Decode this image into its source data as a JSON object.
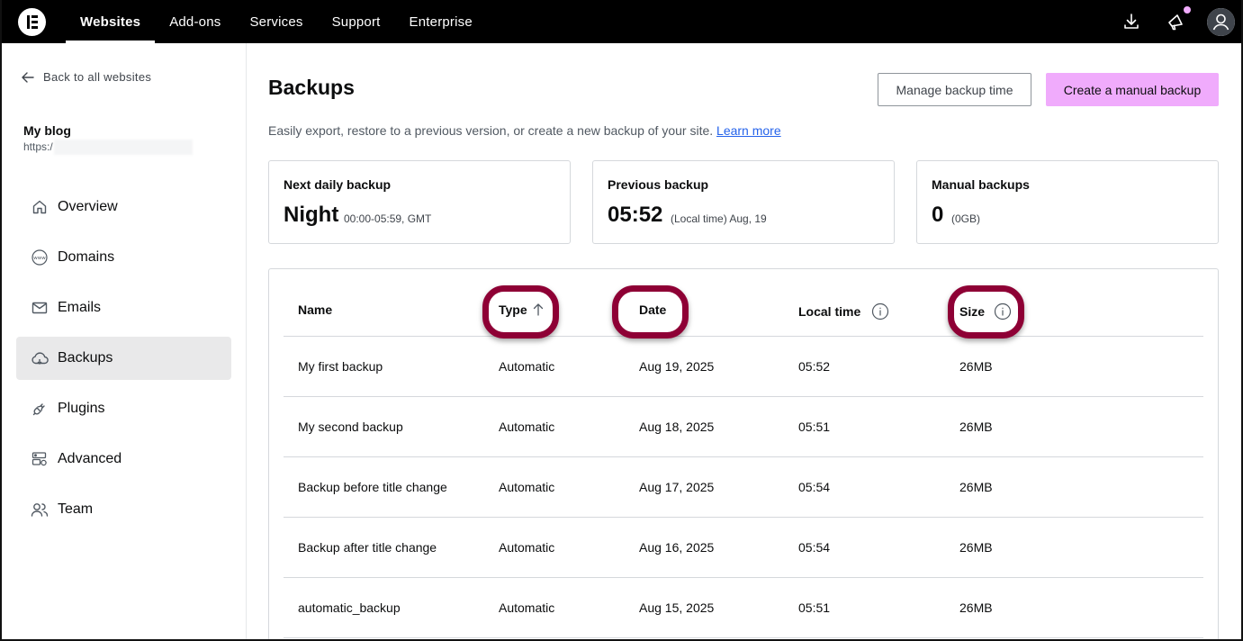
{
  "topbar": {
    "nav": [
      "Websites",
      "Add-ons",
      "Services",
      "Support",
      "Enterprise"
    ],
    "active_nav": "Websites",
    "colors": {
      "background": "#000000",
      "accent": "#f0abfc"
    }
  },
  "sidebar": {
    "back_label": "Back to all websites",
    "site_name": "My blog",
    "site_url": "https:/",
    "items": [
      {
        "label": "Overview",
        "icon": "home-icon"
      },
      {
        "label": "Domains",
        "icon": "globe-www-icon"
      },
      {
        "label": "Emails",
        "icon": "envelope-icon"
      },
      {
        "label": "Backups",
        "icon": "cloud-icon",
        "active": true
      },
      {
        "label": "Plugins",
        "icon": "plug-icon"
      },
      {
        "label": "Advanced",
        "icon": "server-settings-icon"
      },
      {
        "label": "Team",
        "icon": "users-icon"
      }
    ]
  },
  "main": {
    "title": "Backups",
    "manage_button": "Manage backup time",
    "create_button": "Create a manual backup",
    "subtitle": "Easily export, restore to a previous version, or create a new backup of your site.",
    "learn_more": "Learn more",
    "cards": [
      {
        "title": "Next daily backup",
        "value": "Night",
        "note": "00:00-05:59, GMT"
      },
      {
        "title": "Previous backup",
        "value": "05:52",
        "note": "(Local time) Aug, 19"
      },
      {
        "title": "Manual backups",
        "value": "0",
        "note": "(0GB)"
      }
    ],
    "table": {
      "headers": [
        "Name",
        "Type",
        "Date",
        "Local time",
        "Size"
      ],
      "rows": [
        [
          "My first backup",
          "Automatic",
          "Aug 19, 2025",
          "05:52",
          "26MB"
        ],
        [
          "My second backup",
          "Automatic",
          "Aug 18, 2025",
          "05:51",
          "26MB"
        ],
        [
          "Backup before title change",
          "Automatic",
          "Aug 17, 2025",
          "05:54",
          "26MB"
        ],
        [
          "Backup after title change",
          "Automatic",
          "Aug 16, 2025",
          "05:54",
          "26MB"
        ],
        [
          "automatic_backup",
          "Automatic",
          "Aug 15, 2025",
          "05:51",
          "26MB"
        ]
      ]
    },
    "highlight_color": "#8e0035"
  }
}
